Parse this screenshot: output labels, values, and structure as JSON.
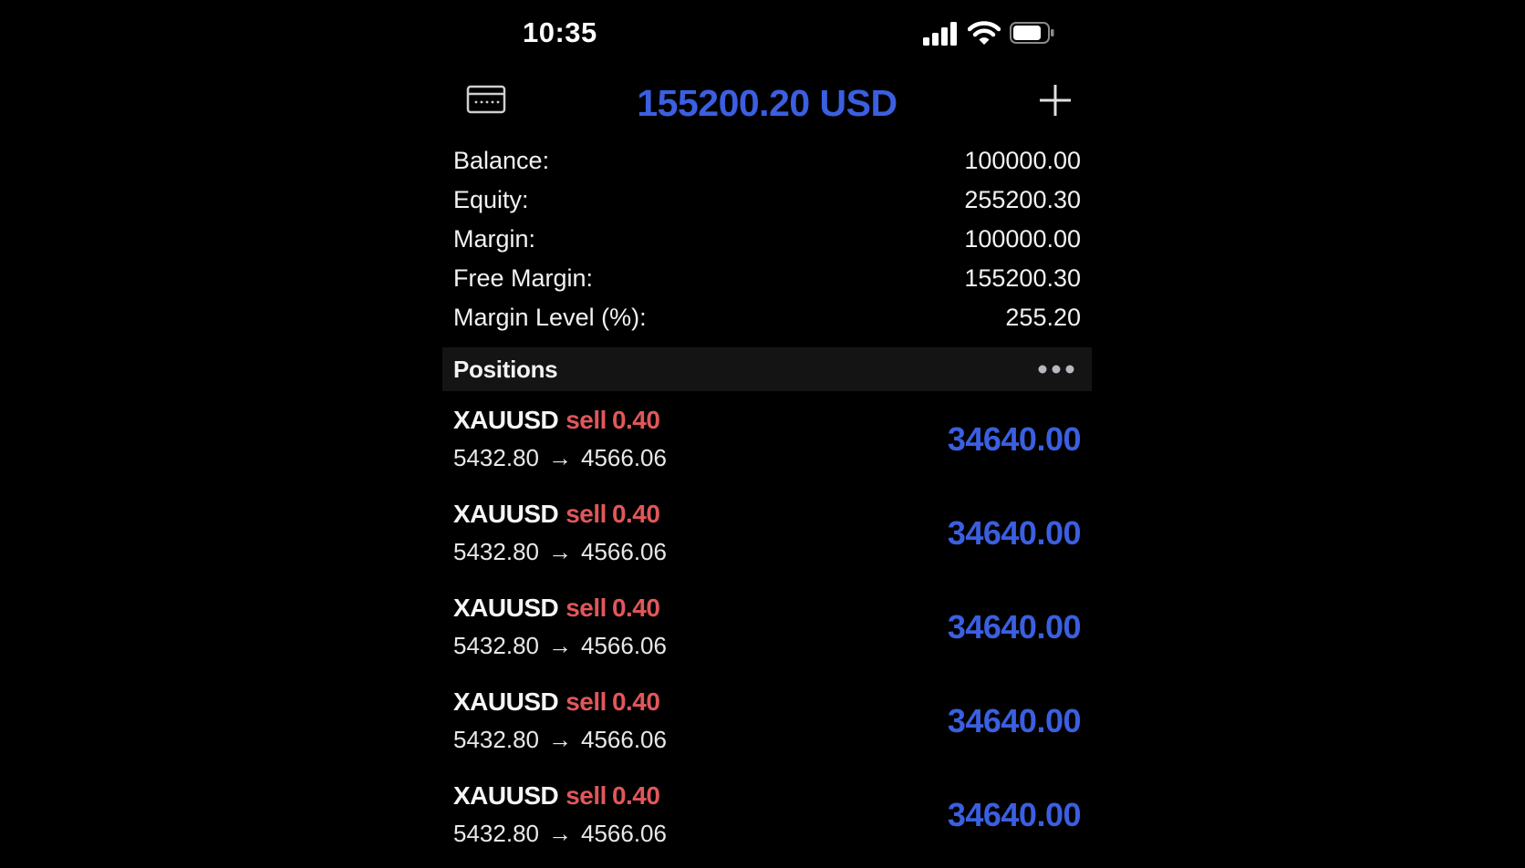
{
  "status_bar": {
    "time": "10:35"
  },
  "header": {
    "title": "155200.20 USD",
    "left_icon": "card-icon",
    "right_icon": "plus-icon"
  },
  "summary": [
    {
      "label": "Balance:",
      "value": "100000.00"
    },
    {
      "label": "Equity:",
      "value": "255200.30"
    },
    {
      "label": "Margin:",
      "value": "100000.00"
    },
    {
      "label": "Free Margin:",
      "value": "155200.30"
    },
    {
      "label": "Margin Level (%):",
      "value": "255.20"
    }
  ],
  "positions_section": {
    "title": "Positions",
    "menu_icon": "more-icon"
  },
  "positions": [
    {
      "symbol": "XAUUSD",
      "side": "sell",
      "lot": "0.40",
      "open": "5432.80",
      "arrow": "→",
      "current": "4566.06",
      "profit": "34640.00"
    },
    {
      "symbol": "XAUUSD",
      "side": "sell",
      "lot": "0.40",
      "open": "5432.80",
      "arrow": "→",
      "current": "4566.06",
      "profit": "34640.00"
    },
    {
      "symbol": "XAUUSD",
      "side": "sell",
      "lot": "0.40",
      "open": "5432.80",
      "arrow": "→",
      "current": "4566.06",
      "profit": "34640.00"
    },
    {
      "symbol": "XAUUSD",
      "side": "sell",
      "lot": "0.40",
      "open": "5432.80",
      "arrow": "→",
      "current": "4566.06",
      "profit": "34640.00"
    },
    {
      "symbol": "XAUUSD",
      "side": "sell",
      "lot": "0.40",
      "open": "5432.80",
      "arrow": "→",
      "current": "4566.06",
      "profit": "34640.00"
    }
  ],
  "colors": {
    "accent": "#3b5fe0",
    "sell": "#e0575a",
    "background": "#000000"
  }
}
